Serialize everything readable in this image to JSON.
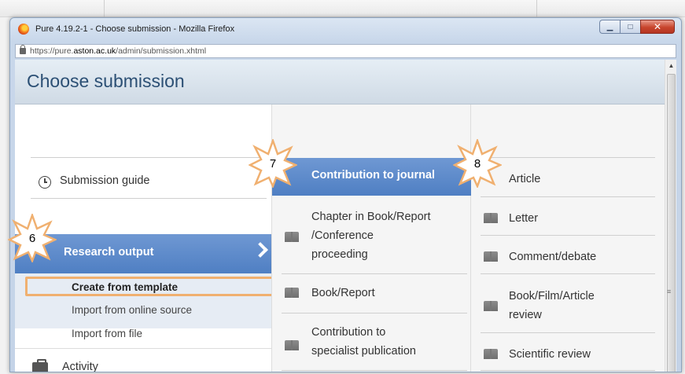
{
  "browser": {
    "window_title": "Pure 4.19.2-1 - Choose submission - Mozilla Firefox",
    "url_prefix": "https://pure.",
    "url_domain": "aston.ac.uk",
    "url_path": "/admin/submission.xhtml"
  },
  "page": {
    "title": "Choose submission"
  },
  "left_menu": {
    "submission_guide": "Submission guide",
    "research_output": "Research output",
    "submenu": [
      "Create from template",
      "Import from online source",
      "Import from file"
    ],
    "activity": "Activity"
  },
  "middle_menu": {
    "contribution_to_journal": "Contribution to journal",
    "chapter": [
      "Chapter in Book/Report",
      "/Conference",
      "proceeding"
    ],
    "book_report": "Book/Report",
    "specialist": [
      "Contribution to",
      "specialist publication"
    ]
  },
  "right_menu": {
    "items": [
      "Article",
      "Letter",
      "Comment/debate"
    ],
    "review": [
      "Book/Film/Article",
      "review"
    ],
    "scientific_review": "Scientific review"
  },
  "callouts": [
    "6",
    "7",
    "8"
  ],
  "colors": {
    "accent_blue": "#4f7fc3",
    "callout_border": "#f0b070"
  }
}
